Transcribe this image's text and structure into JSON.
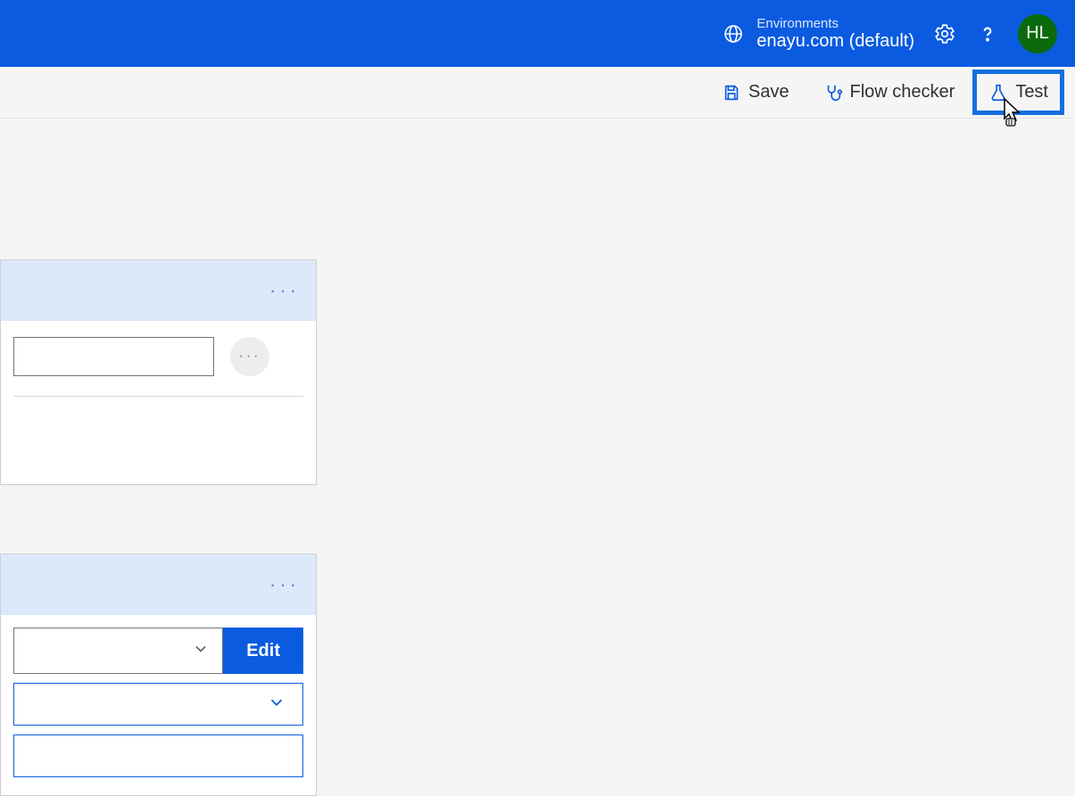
{
  "header": {
    "env_label": "Environments",
    "env_name": "enayu.com (default)",
    "avatar_initials": "HL"
  },
  "toolbar": {
    "save_label": "Save",
    "flow_checker_label": "Flow checker",
    "test_label": "Test"
  },
  "card1": {
    "more": "···",
    "ellipsis": "···"
  },
  "card2": {
    "more": "···",
    "edit_label": "Edit"
  }
}
